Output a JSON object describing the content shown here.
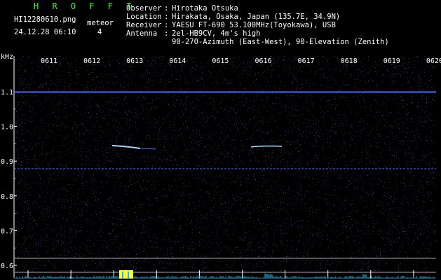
{
  "header": {
    "title": "H R O F F T",
    "filename": "HI12280610.png",
    "datetime": "24.12.28 06:10",
    "meteor_label": "meteor",
    "meteor_count": "4"
  },
  "station": {
    "observer_label": "Observer",
    "observer": "Hirotaka Otsuka",
    "location_label": "Location",
    "location": "Hirakata, Osaka, Japan (135.7E, 34.9N)",
    "receiver_label": "Receiver",
    "receiver": "YAESU FT-690 53.100MHz(Toyokawa), USB",
    "antenna_label": "Antenna",
    "antenna": "2el-HB9CV, 4m's high",
    "antenna_line2": "90-270-Azimuth (East-West), 90-Elevation (Zenith)"
  },
  "axis": {
    "y_unit": "kHz",
    "y_ticks": [
      "1.1",
      "1.0",
      "0.9",
      "0.8",
      "0.7",
      "0.6"
    ],
    "x_ticks": [
      "0611",
      "0612",
      "0613",
      "0614",
      "0615",
      "0616",
      "0617",
      "0618",
      "0619",
      "0620"
    ]
  },
  "colors": {
    "background": "#000000",
    "noise": "#2a2a6a",
    "carrier": "#4a6aff",
    "echo": "#9fd4ff",
    "level": "#33ccff",
    "peak": "#ffff33"
  }
}
